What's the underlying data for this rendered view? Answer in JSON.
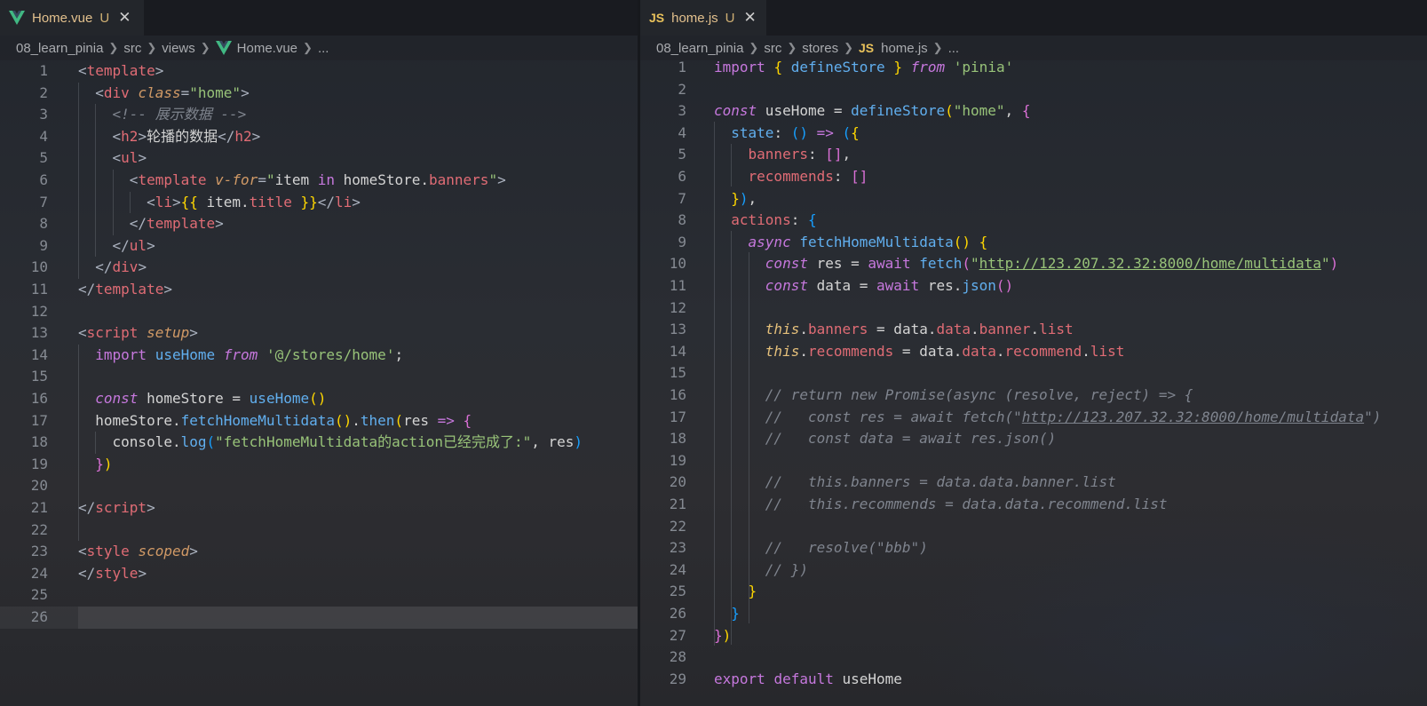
{
  "left": {
    "tab": {
      "name": "Home.vue",
      "badge": "U",
      "close": "✕"
    },
    "breadcrumb": [
      "08_learn_pinia",
      "src",
      "views",
      "Home.vue",
      "..."
    ],
    "lines": [
      [
        [
          "t-punc",
          "<"
        ],
        [
          "t-tag",
          "template"
        ],
        [
          "t-punc",
          ">"
        ]
      ],
      [
        [
          "t-var",
          "  "
        ],
        [
          "t-punc",
          "<"
        ],
        [
          "t-tag",
          "div"
        ],
        [
          "t-var",
          " "
        ],
        [
          "t-attr",
          "class"
        ],
        [
          "t-punc",
          "="
        ],
        [
          "t-str",
          "\"home\""
        ],
        [
          "t-punc",
          ">"
        ]
      ],
      [
        [
          "t-var",
          "    "
        ],
        [
          "t-com",
          "<!-- 展示数据 -->"
        ]
      ],
      [
        [
          "t-var",
          "    "
        ],
        [
          "t-punc",
          "<"
        ],
        [
          "t-tag",
          "h2"
        ],
        [
          "t-punc",
          ">"
        ],
        [
          "t-var",
          "轮播的数据"
        ],
        [
          "t-punc",
          "</"
        ],
        [
          "t-tag",
          "h2"
        ],
        [
          "t-punc",
          ">"
        ]
      ],
      [
        [
          "t-var",
          "    "
        ],
        [
          "t-punc",
          "<"
        ],
        [
          "t-tag",
          "ul"
        ],
        [
          "t-punc",
          ">"
        ]
      ],
      [
        [
          "t-var",
          "      "
        ],
        [
          "t-punc",
          "<"
        ],
        [
          "t-tag",
          "template"
        ],
        [
          "t-var",
          " "
        ],
        [
          "t-attr",
          "v-for"
        ],
        [
          "t-punc",
          "="
        ],
        [
          "t-str",
          "\""
        ],
        [
          "t-var",
          "item "
        ],
        [
          "t-kw",
          "in"
        ],
        [
          "t-var",
          " homeStore."
        ],
        [
          "t-prop",
          "banners"
        ],
        [
          "t-str",
          "\""
        ],
        [
          "t-punc",
          ">"
        ]
      ],
      [
        [
          "t-var",
          "        "
        ],
        [
          "t-punc",
          "<"
        ],
        [
          "t-tag",
          "li"
        ],
        [
          "t-punc",
          ">"
        ],
        [
          "t-br1",
          "{{"
        ],
        [
          "t-var",
          " item."
        ],
        [
          "t-prop",
          "title"
        ],
        [
          "t-var",
          " "
        ],
        [
          "t-br1",
          "}}"
        ],
        [
          "t-punc",
          "</"
        ],
        [
          "t-tag",
          "li"
        ],
        [
          "t-punc",
          ">"
        ]
      ],
      [
        [
          "t-var",
          "      "
        ],
        [
          "t-punc",
          "</"
        ],
        [
          "t-tag",
          "template"
        ],
        [
          "t-punc",
          ">"
        ]
      ],
      [
        [
          "t-var",
          "    "
        ],
        [
          "t-punc",
          "</"
        ],
        [
          "t-tag",
          "ul"
        ],
        [
          "t-punc",
          ">"
        ]
      ],
      [
        [
          "t-var",
          "  "
        ],
        [
          "t-punc",
          "</"
        ],
        [
          "t-tag",
          "div"
        ],
        [
          "t-punc",
          ">"
        ]
      ],
      [
        [
          "t-punc",
          "</"
        ],
        [
          "t-tag",
          "template"
        ],
        [
          "t-punc",
          ">"
        ]
      ],
      [],
      [
        [
          "t-punc",
          "<"
        ],
        [
          "t-tag",
          "script"
        ],
        [
          "t-var",
          " "
        ],
        [
          "t-attr",
          "setup"
        ],
        [
          "t-punc",
          ">"
        ]
      ],
      [
        [
          "t-var",
          "  "
        ],
        [
          "t-kw",
          "import"
        ],
        [
          "t-var",
          " "
        ],
        [
          "t-fn",
          "useHome"
        ],
        [
          "t-var",
          " "
        ],
        [
          "t-kwi",
          "from"
        ],
        [
          "t-var",
          " "
        ],
        [
          "t-str",
          "'@/stores/home'"
        ],
        [
          "t-var",
          ";"
        ]
      ],
      [],
      [
        [
          "t-var",
          "  "
        ],
        [
          "t-kwi",
          "const"
        ],
        [
          "t-var",
          " homeStore = "
        ],
        [
          "t-fn",
          "useHome"
        ],
        [
          "t-br1",
          "()"
        ]
      ],
      [
        [
          "t-var",
          "  homeStore."
        ],
        [
          "t-fn",
          "fetchHomeMultidata"
        ],
        [
          "t-br1",
          "()"
        ],
        [
          "t-var",
          "."
        ],
        [
          "t-fn",
          "then"
        ],
        [
          "t-br1",
          "("
        ],
        [
          "t-var",
          "res "
        ],
        [
          "t-kw",
          "=>"
        ],
        [
          "t-var",
          " "
        ],
        [
          "t-br2",
          "{"
        ]
      ],
      [
        [
          "t-var",
          "    console."
        ],
        [
          "t-fn",
          "log"
        ],
        [
          "t-br3",
          "("
        ],
        [
          "t-str",
          "\"fetchHomeMultidata的action已经完成了:\""
        ],
        [
          "t-var",
          ", res"
        ],
        [
          "t-br3",
          ")"
        ]
      ],
      [
        [
          "t-var",
          "  "
        ],
        [
          "t-br2",
          "}"
        ],
        [
          "t-br1",
          ")"
        ]
      ],
      [],
      [
        [
          "t-punc",
          "</"
        ],
        [
          "t-tag",
          "script"
        ],
        [
          "t-punc",
          ">"
        ]
      ],
      [],
      [
        [
          "t-punc",
          "<"
        ],
        [
          "t-tag",
          "style"
        ],
        [
          "t-var",
          " "
        ],
        [
          "t-attr",
          "scoped"
        ],
        [
          "t-punc",
          ">"
        ]
      ],
      [
        [
          "t-punc",
          "</"
        ],
        [
          "t-tag",
          "style"
        ],
        [
          "t-punc",
          ">"
        ]
      ],
      [],
      []
    ]
  },
  "right": {
    "tab": {
      "name": "home.js",
      "badge": "U",
      "close": "✕",
      "icon_label": "JS"
    },
    "breadcrumb": [
      "08_learn_pinia",
      "src",
      "stores",
      "home.js",
      "..."
    ],
    "lines": [
      [
        [
          "t-kw",
          "import"
        ],
        [
          "t-var",
          " "
        ],
        [
          "t-br1",
          "{"
        ],
        [
          "t-var",
          " "
        ],
        [
          "t-fn",
          "defineStore"
        ],
        [
          "t-var",
          " "
        ],
        [
          "t-br1",
          "}"
        ],
        [
          "t-var",
          " "
        ],
        [
          "t-kwi",
          "from"
        ],
        [
          "t-var",
          " "
        ],
        [
          "t-str",
          "'pinia'"
        ]
      ],
      [],
      [
        [
          "t-kwi",
          "const"
        ],
        [
          "t-var",
          " useHome = "
        ],
        [
          "t-fn",
          "defineStore"
        ],
        [
          "t-br1",
          "("
        ],
        [
          "t-str",
          "\"home\""
        ],
        [
          "t-var",
          ", "
        ],
        [
          "t-br2",
          "{"
        ]
      ],
      [
        [
          "t-var",
          "  "
        ],
        [
          "t-fn",
          "state"
        ],
        [
          "t-var",
          ": "
        ],
        [
          "t-br3",
          "()"
        ],
        [
          "t-var",
          " "
        ],
        [
          "t-kw",
          "=>"
        ],
        [
          "t-var",
          " "
        ],
        [
          "t-br3",
          "("
        ],
        [
          "t-br1",
          "{"
        ]
      ],
      [
        [
          "t-var",
          "    "
        ],
        [
          "t-prop",
          "banners"
        ],
        [
          "t-var",
          ": "
        ],
        [
          "t-br2",
          "[]"
        ],
        [
          "t-var",
          ","
        ]
      ],
      [
        [
          "t-var",
          "    "
        ],
        [
          "t-prop",
          "recommends"
        ],
        [
          "t-var",
          ": "
        ],
        [
          "t-br2",
          "[]"
        ]
      ],
      [
        [
          "t-var",
          "  "
        ],
        [
          "t-br1",
          "}"
        ],
        [
          "t-br3",
          ")"
        ],
        [
          "t-var",
          ","
        ]
      ],
      [
        [
          "t-var",
          "  "
        ],
        [
          "t-prop",
          "actions"
        ],
        [
          "t-var",
          ": "
        ],
        [
          "t-br3",
          "{"
        ]
      ],
      [
        [
          "t-var",
          "    "
        ],
        [
          "t-kwi",
          "async"
        ],
        [
          "t-var",
          " "
        ],
        [
          "t-fn",
          "fetchHomeMultidata"
        ],
        [
          "t-br1",
          "()"
        ],
        [
          "t-var",
          " "
        ],
        [
          "t-br1",
          "{"
        ]
      ],
      [
        [
          "t-var",
          "      "
        ],
        [
          "t-kwi",
          "const"
        ],
        [
          "t-var",
          " res = "
        ],
        [
          "t-kw",
          "await"
        ],
        [
          "t-var",
          " "
        ],
        [
          "t-fn",
          "fetch"
        ],
        [
          "t-br2",
          "("
        ],
        [
          "t-str",
          "\""
        ],
        [
          "t-str t-url",
          "http://123.207.32.32:8000/home/multidata"
        ],
        [
          "t-str",
          "\""
        ],
        [
          "t-br2",
          ")"
        ]
      ],
      [
        [
          "t-var",
          "      "
        ],
        [
          "t-kwi",
          "const"
        ],
        [
          "t-var",
          " data = "
        ],
        [
          "t-kw",
          "await"
        ],
        [
          "t-var",
          " res."
        ],
        [
          "t-fn",
          "json"
        ],
        [
          "t-br2",
          "()"
        ]
      ],
      [],
      [
        [
          "t-var",
          "      "
        ],
        [
          "t-this",
          "this"
        ],
        [
          "t-var",
          "."
        ],
        [
          "t-prop",
          "banners"
        ],
        [
          "t-var",
          " = data."
        ],
        [
          "t-prop",
          "data"
        ],
        [
          "t-var",
          "."
        ],
        [
          "t-prop",
          "banner"
        ],
        [
          "t-var",
          "."
        ],
        [
          "t-prop",
          "list"
        ]
      ],
      [
        [
          "t-var",
          "      "
        ],
        [
          "t-this",
          "this"
        ],
        [
          "t-var",
          "."
        ],
        [
          "t-prop",
          "recommends"
        ],
        [
          "t-var",
          " = data."
        ],
        [
          "t-prop",
          "data"
        ],
        [
          "t-var",
          "."
        ],
        [
          "t-prop",
          "recommend"
        ],
        [
          "t-var",
          "."
        ],
        [
          "t-prop",
          "list"
        ]
      ],
      [],
      [
        [
          "t-var",
          "      "
        ],
        [
          "t-com",
          "// return new Promise(async (resolve, reject) => {"
        ]
      ],
      [
        [
          "t-var",
          "      "
        ],
        [
          "t-com",
          "//   const res = await fetch(\""
        ],
        [
          "t-com t-url",
          "http://123.207.32.32:8000/home/multidata"
        ],
        [
          "t-com",
          "\")"
        ]
      ],
      [
        [
          "t-var",
          "      "
        ],
        [
          "t-com",
          "//   const data = await res.json()"
        ]
      ],
      [],
      [
        [
          "t-var",
          "      "
        ],
        [
          "t-com",
          "//   this.banners = data.data.banner.list"
        ]
      ],
      [
        [
          "t-var",
          "      "
        ],
        [
          "t-com",
          "//   this.recommends = data.data.recommend.list"
        ]
      ],
      [],
      [
        [
          "t-var",
          "      "
        ],
        [
          "t-com",
          "//   resolve(\"bbb\")"
        ]
      ],
      [
        [
          "t-var",
          "      "
        ],
        [
          "t-com",
          "// })"
        ]
      ],
      [
        [
          "t-var",
          "    "
        ],
        [
          "t-br1",
          "}"
        ]
      ],
      [
        [
          "t-var",
          "  "
        ],
        [
          "t-br3",
          "}"
        ]
      ],
      [
        [
          "t-br2",
          "}"
        ],
        [
          "t-br1",
          ")"
        ]
      ],
      [],
      [
        [
          "t-kw",
          "export"
        ],
        [
          "t-var",
          " "
        ],
        [
          "t-kw",
          "default"
        ],
        [
          "t-var",
          " useHome"
        ]
      ]
    ]
  },
  "colors": {
    "vue_icon": "#41b883",
    "js_icon": "#e8c15b",
    "modified_file": "#e2c08d"
  }
}
